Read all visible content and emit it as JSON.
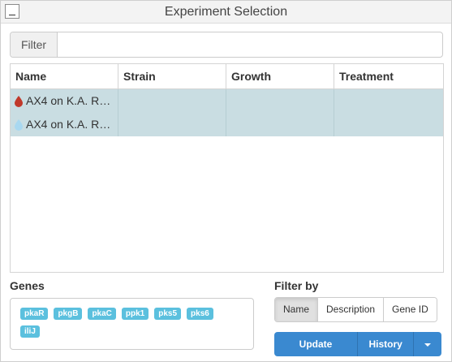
{
  "window": {
    "title": "Experiment Selection"
  },
  "filter": {
    "label": "Filter",
    "value": "",
    "placeholder": ""
  },
  "table": {
    "columns": [
      "Name",
      "Strain",
      "Growth",
      "Treatment"
    ],
    "rows": [
      {
        "name": "AX4 on K.A. R…",
        "strain": "",
        "growth": "",
        "treatment": "",
        "icon": "blood-drop-icon",
        "icon_color": "#c0392b"
      },
      {
        "name": "AX4 on K.A. R…",
        "strain": "",
        "growth": "",
        "treatment": "",
        "icon": "water-drop-icon",
        "icon_color": "#a8d8f0"
      }
    ]
  },
  "genes": {
    "label": "Genes",
    "tags": [
      "pkaR",
      "pkgB",
      "pkaC",
      "ppk1",
      "pks5",
      "pks6",
      "iliJ"
    ],
    "tag_color": "#5bc0de"
  },
  "filter_by": {
    "label": "Filter by",
    "options": [
      "Name",
      "Description",
      "Gene ID"
    ],
    "selected": "Name"
  },
  "actions": {
    "update_label": "Update",
    "history_label": "History",
    "accent": "#3a89d0"
  }
}
